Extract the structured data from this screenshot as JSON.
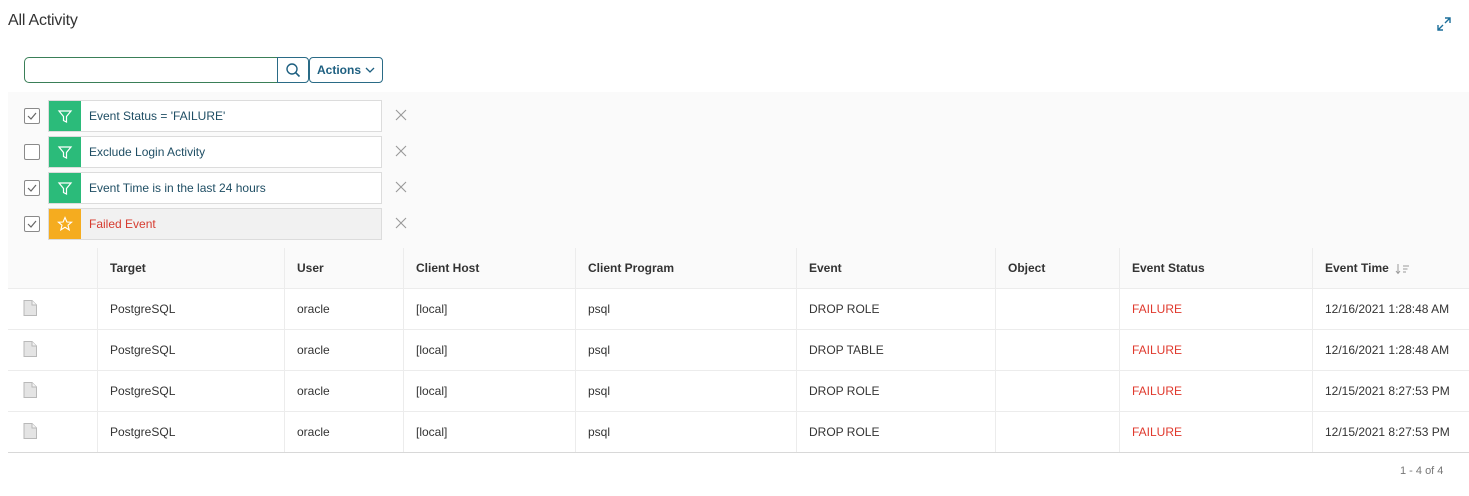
{
  "page": {
    "title": "All Activity"
  },
  "search": {
    "value": "",
    "placeholder": "",
    "button_icon": "search-icon"
  },
  "toolbar": {
    "actions_label": "Actions",
    "expand_icon": "expand-icon"
  },
  "filters": [
    {
      "label": "Event Status = 'FAILURE'",
      "checked": true,
      "icon": "filter-icon",
      "kind": "filter"
    },
    {
      "label": "Exclude Login Activity",
      "checked": false,
      "icon": "filter-icon",
      "kind": "filter"
    },
    {
      "label": "Event Time is in the last 24 hours",
      "checked": true,
      "icon": "filter-icon",
      "kind": "filter"
    },
    {
      "label": "Failed Event",
      "checked": true,
      "icon": "star-icon",
      "kind": "saved",
      "selected": true
    }
  ],
  "table": {
    "columns": [
      "Target",
      "User",
      "Client Host",
      "Client Program",
      "Event",
      "Object",
      "Event Status",
      "Event Time"
    ],
    "sorted_column": "Event Time",
    "sort_direction": "descending",
    "rows": [
      {
        "target": "PostgreSQL",
        "user": "oracle",
        "client_host": "[local]",
        "client_program": "psql",
        "event": "DROP ROLE",
        "object": "",
        "status": "FAILURE",
        "time": "12/16/2021 1:28:48 AM"
      },
      {
        "target": "PostgreSQL",
        "user": "oracle",
        "client_host": "[local]",
        "client_program": "psql",
        "event": "DROP TABLE",
        "object": "",
        "status": "FAILURE",
        "time": "12/16/2021 1:28:48 AM"
      },
      {
        "target": "PostgreSQL",
        "user": "oracle",
        "client_host": "[local]",
        "client_program": "psql",
        "event": "DROP ROLE",
        "object": "",
        "status": "FAILURE",
        "time": "12/15/2021 8:27:53 PM"
      },
      {
        "target": "PostgreSQL",
        "user": "oracle",
        "client_host": "[local]",
        "client_program": "psql",
        "event": "DROP ROLE",
        "object": "",
        "status": "FAILURE",
        "time": "12/15/2021 8:27:53 PM"
      }
    ]
  },
  "pagination": {
    "label": "1 - 4 of 4"
  },
  "colors": {
    "filter_green": "#2bbb7a",
    "saved_orange": "#f5ac1f",
    "failure_red": "#e0392d",
    "link_blue": "#1d5f80"
  }
}
